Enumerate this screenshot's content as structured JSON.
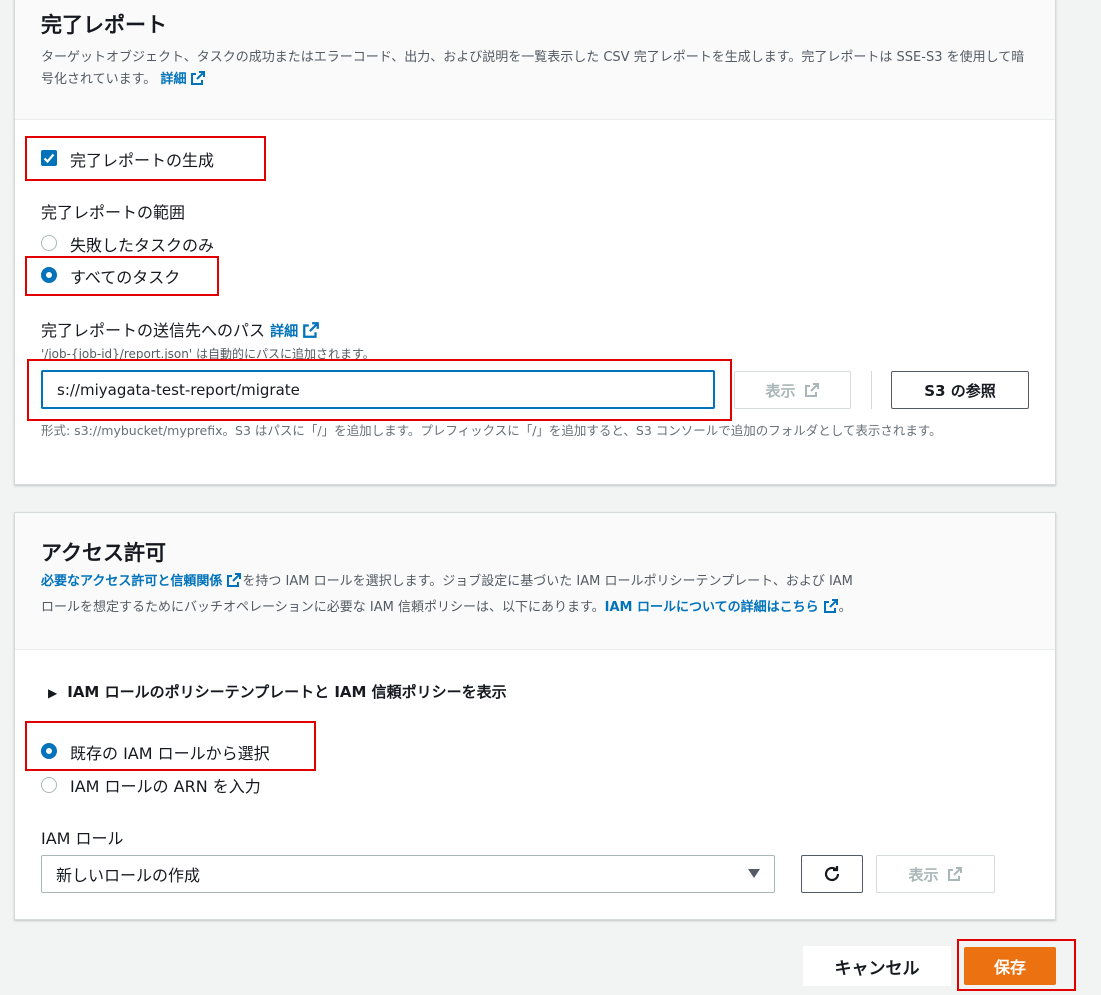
{
  "completion_report": {
    "title": "完了レポート",
    "description": "ターゲットオブジェクト、タスクの成功またはエラーコード、出力、および説明を一覧表示した CSV 完了レポートを生成します。完了レポートは SSE-S3 を使用して暗号化されています。",
    "detail_link": "詳細",
    "generate_checkbox_label": "完了レポートの生成",
    "scope_label": "完了レポートの範囲",
    "scope_options": [
      "失敗したタスクのみ",
      "すべてのタスク"
    ],
    "scope_selected": "すべてのタスク",
    "path_label": "完了レポートの送信先へのパス",
    "path_detail_link": "詳細",
    "path_hint": "'/job-{job-id}/report.json' は自動的にパスに追加されます。",
    "path_value": "s://miyagata-test-report/migrate",
    "view_button": "表示",
    "browse_button": "S3 の参照",
    "format_hint": "形式: s3://mybucket/myprefix。S3 はパスに「/」を追加します。プレフィックスに「/」を追加すると、S3 コンソールで追加のフォルダとして表示されます。"
  },
  "access": {
    "title": "アクセス許可",
    "desc_link1": "必要なアクセス許可と信頼関係",
    "desc_text1": "を持つ IAM ロールを選択します。ジョブ設定に基づいた IAM ロールポリシーテンプレート、および IAM",
    "desc_text2": "ロールを想定するためにバッチオペレーションに必要な IAM 信頼ポリシーは、以下にあります。",
    "desc_link2": "IAM ロールについての詳細はこちら",
    "desc_end": "。",
    "expand_label": "IAM ロールのポリシーテンプレートと IAM 信頼ポリシーを表示",
    "role_options": [
      "既存の IAM ロールから選択",
      "IAM ロールの ARN を入力"
    ],
    "role_selected": "既存の IAM ロールから選択",
    "role_field_label": "IAM ロール",
    "role_select_value": "新しいロールの作成",
    "view_button": "表示"
  },
  "footer": {
    "cancel": "キャンセル",
    "save": "保存"
  },
  "colors": {
    "accent": "#0073bb",
    "primary_button": "#ec7211",
    "highlight_box": "#e00000"
  }
}
